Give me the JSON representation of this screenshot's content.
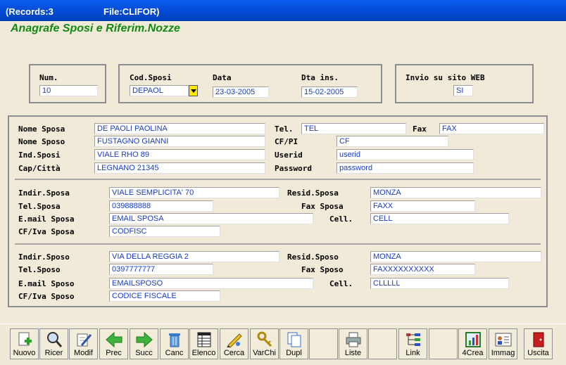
{
  "titlebar": {
    "records": "(Records:3",
    "file": "File:CLIFOR)"
  },
  "app_title": "Anagrafe Sposi e Riferim.Nozze",
  "top": {
    "num": {
      "label": "Num.",
      "value": "10"
    },
    "cod_sposi": {
      "label": "Cod.Sposi",
      "value": "DEPAOL"
    },
    "data": {
      "label": "Data",
      "value": "23-03-2005"
    },
    "dta_ins": {
      "label": "Dta ins.",
      "value": "15-02-2005"
    },
    "invio": {
      "label": "Invio su sito WEB",
      "value": "SI"
    }
  },
  "main": {
    "nome_sposa": {
      "label": "Nome Sposa",
      "value": "DE PAOLI PAOLINA"
    },
    "nome_sposo": {
      "label": "Nome Sposo",
      "value": "FUSTAGNO GIANNI"
    },
    "ind_sposi": {
      "label": "Ind.Sposi",
      "value": "VIALE RHO 89"
    },
    "cap_citta": {
      "label": "Cap/Città",
      "value": "LEGNANO 21345"
    },
    "tel": {
      "label": "Tel.",
      "value": "TEL"
    },
    "fax": {
      "label": "Fax",
      "value": "FAX"
    },
    "cf_pi": {
      "label": "CF/PI",
      "value": "CF"
    },
    "userid": {
      "label": "Userid",
      "value": "userid"
    },
    "password": {
      "label": "Password",
      "value": "password"
    }
  },
  "sposa": {
    "indir": {
      "label": "Indir.Sposa",
      "value": "VIALE SEMPLICITA' 70"
    },
    "tel": {
      "label": "Tel.Sposa",
      "value": "039888888"
    },
    "email": {
      "label": "E.mail Sposa",
      "value": "EMAIL SPOSA"
    },
    "cfiva": {
      "label": "CF/Iva Sposa",
      "value": "CODFISC"
    },
    "resid": {
      "label": "Resid.Sposa",
      "value": "MONZA"
    },
    "fax": {
      "label": "Fax Sposa",
      "value": "FAXX"
    },
    "cell": {
      "label": "Cell.",
      "value": "CELL"
    }
  },
  "sposo": {
    "indir": {
      "label": "Indir.Sposo",
      "value": "VIA DELLA REGGIA 2"
    },
    "tel": {
      "label": "Tel.Sposo",
      "value": "0397777777"
    },
    "email": {
      "label": "E.mail Sposo",
      "value": "EMAILSPOSO"
    },
    "cfiva": {
      "label": "CF/Iva Sposo",
      "value": "CODICE FISCALE"
    },
    "resid": {
      "label": "Resid.Sposo",
      "value": "MONZA"
    },
    "fax": {
      "label": "Fax Sposo",
      "value": "FAXXXXXXXXXX"
    },
    "cell": {
      "label": "Cell.",
      "value": "CLLLLL"
    }
  },
  "toolbar": [
    {
      "label": "Nuovo",
      "icon": "new-icon"
    },
    {
      "label": "Ricer",
      "icon": "magnifier-icon"
    },
    {
      "label": "Modif",
      "icon": "edit-icon"
    },
    {
      "label": "Prec",
      "icon": "arrow-left-icon"
    },
    {
      "label": "Succ",
      "icon": "arrow-right-icon"
    },
    {
      "label": "Canc",
      "icon": "trash-icon"
    },
    {
      "label": "Elenco",
      "icon": "list-icon"
    },
    {
      "label": "Cerca",
      "icon": "search-pen-icon"
    },
    {
      "label": "VarChi",
      "icon": "keys-icon"
    },
    {
      "label": "Dupl",
      "icon": "duplicate-icon"
    },
    {
      "label": "Liste",
      "icon": "printer-icon"
    },
    {
      "label": "Link",
      "icon": "link-tree-icon"
    },
    {
      "label": "4Crea",
      "icon": "chart-icon"
    },
    {
      "label": "Immag",
      "icon": "image-card-icon"
    },
    {
      "label": "Uscita",
      "icon": "exit-door-icon"
    }
  ],
  "colors": {
    "title_bar": "#0248d0",
    "app_title": "#128a12",
    "field_text": "#1a3cc0",
    "dropdown": "#ffe800"
  }
}
